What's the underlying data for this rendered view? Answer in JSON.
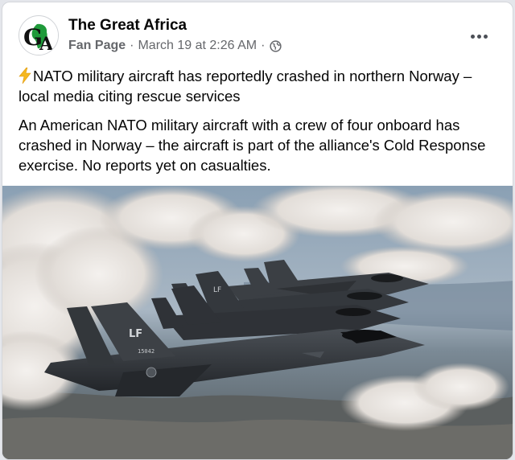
{
  "post": {
    "page_name": "The Great Africa",
    "page_type": "Fan Page",
    "timestamp": "March 19 at 2:26 AM",
    "separator": "·",
    "privacy_icon": "globe-icon",
    "headline_icon": "lightning-bolt-icon",
    "headline": "NATO military aircraft has reportedly crashed in northern Norway – local media citing rescue services",
    "body": "An American NATO military aircraft with a crew of four onboard has crashed in Norway – the aircraft is part of the alliance's Cold Response exercise.  No reports yet on casualties.",
    "more_icon": "more-options-icon"
  },
  "photo": {
    "tail_marking": "LF",
    "serial": "15042"
  },
  "colors": {
    "card_bg": "#ffffff",
    "secondary_text": "#65676b",
    "bolt": "#f5b820",
    "logo_green": "#1f9a3a"
  }
}
